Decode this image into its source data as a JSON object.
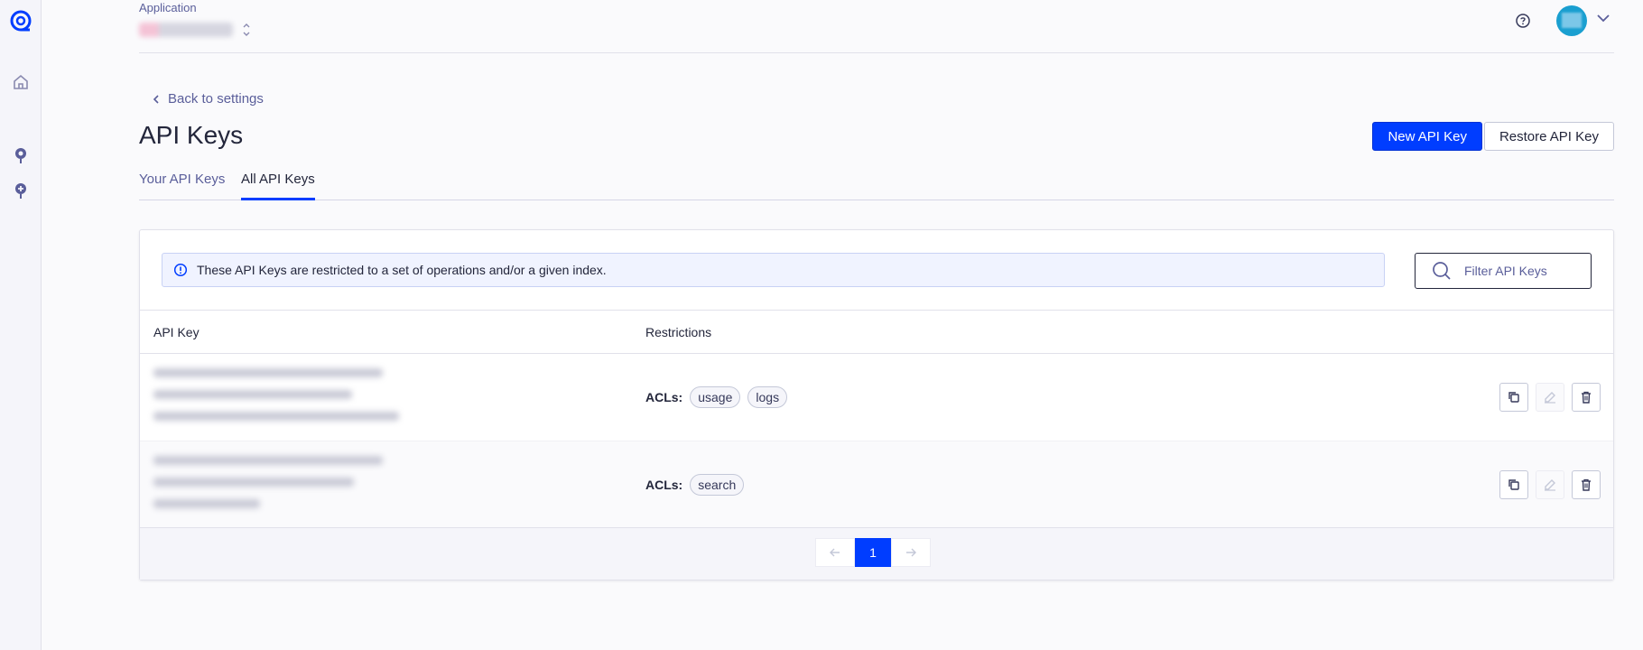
{
  "topbar": {
    "application_label": "Application"
  },
  "nav": {
    "back_label": "Back to settings"
  },
  "page": {
    "title": "API Keys",
    "new_key_button": "New API Key",
    "restore_key_button": "Restore API Key"
  },
  "tabs": [
    {
      "label": "Your API Keys",
      "active": false
    },
    {
      "label": "All API Keys",
      "active": true
    }
  ],
  "banner": {
    "text": "These API Keys are restricted to a set of operations and/or a given index."
  },
  "filter": {
    "placeholder": "Filter API Keys"
  },
  "table": {
    "columns": [
      "API Key",
      "Restrictions"
    ],
    "rows": [
      {
        "acl_label": "ACLs:",
        "acls": [
          "usage",
          "logs"
        ]
      },
      {
        "acl_label": "ACLs:",
        "acls": [
          "search"
        ]
      }
    ]
  },
  "pagination": {
    "current_page": "1",
    "prev_icon": "arrow-left-icon",
    "next_icon": "arrow-right-icon"
  },
  "colors": {
    "accent": "#003dff",
    "text": "#23263b",
    "muted": "#5a5e9a"
  }
}
